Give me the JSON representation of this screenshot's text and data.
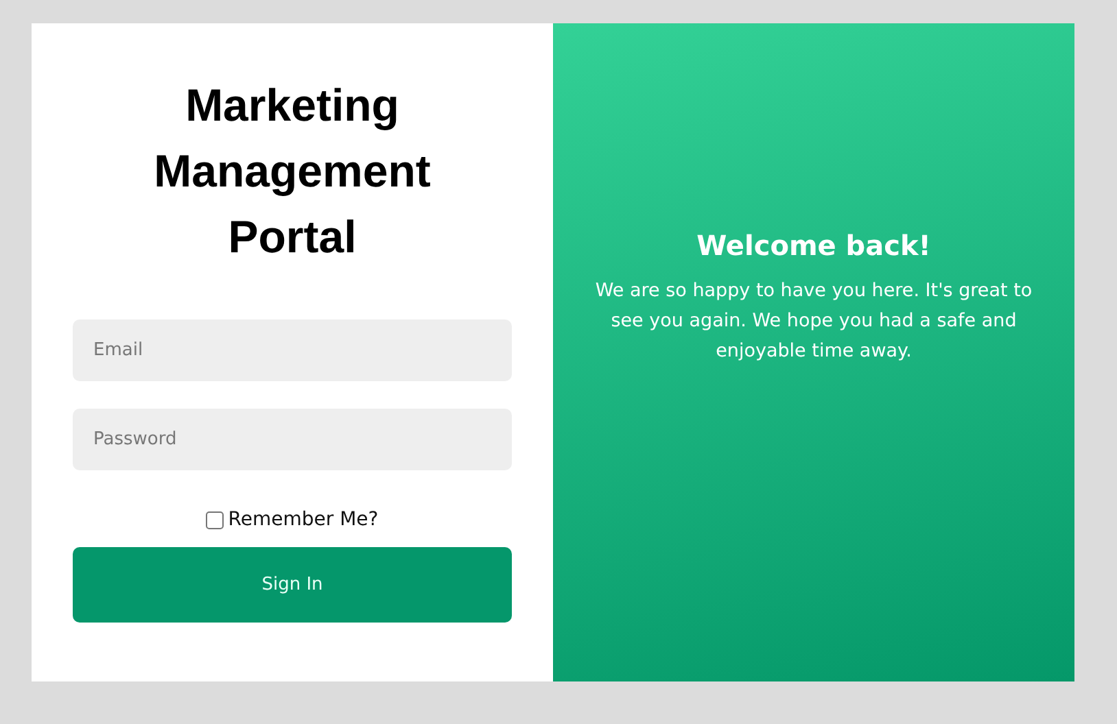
{
  "title": "Marketing Management Portal",
  "fields": [
    {
      "placeholder": "Email"
    },
    {
      "placeholder": "Password"
    }
  ],
  "remember": {
    "label": "Remember Me?",
    "checked": false
  },
  "sign_in_button": "Sign In",
  "welcome": {
    "heading": "Welcome back!",
    "message": "We are so happy to have you here. It's great to see you again. We hope you had a safe and enjoyable time away."
  }
}
